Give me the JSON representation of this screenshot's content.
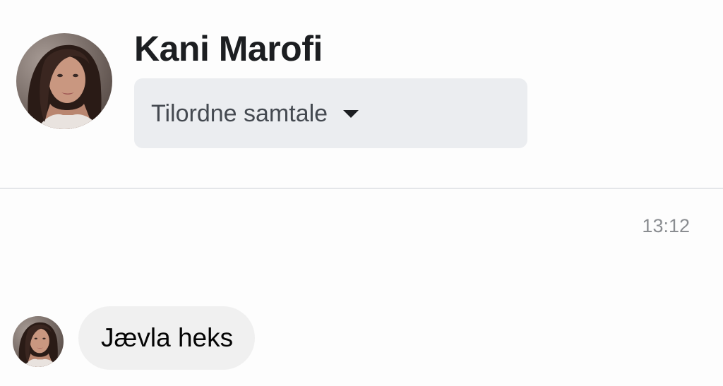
{
  "header": {
    "contact_name": "Kani Marofi",
    "assign_dropdown": {
      "selected_label": "Tilordne samtale"
    },
    "avatar_icon": "profile-photo"
  },
  "thread": {
    "timestamp": "13:12",
    "messages": [
      {
        "direction": "incoming",
        "text": "Jævla heks",
        "avatar_icon": "profile-photo"
      }
    ]
  },
  "colors": {
    "background": "#fdfdfd",
    "dropdown_bg": "#ebedf0",
    "bubble_bg": "#f0f0f0",
    "timestamp": "#8a8d91",
    "divider": "#e4e6e9"
  }
}
